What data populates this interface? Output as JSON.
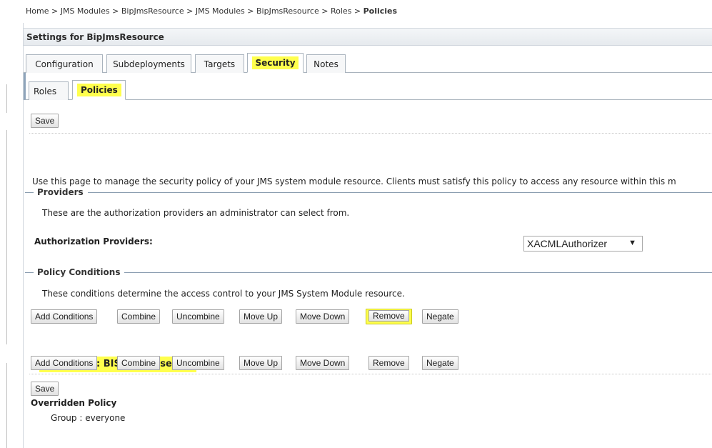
{
  "breadcrumb": {
    "items": [
      "Home",
      "JMS Modules",
      "BipJmsResource",
      "JMS Modules",
      "BipJmsResource",
      "Roles"
    ],
    "current": "Policies",
    "separator": ">"
  },
  "settings": {
    "title": "Settings for BipJmsResource"
  },
  "tabs": {
    "configuration": "Configuration",
    "subdeployments": "Subdeployments",
    "targets": "Targets",
    "security": "Security",
    "notes": "Notes"
  },
  "subtabs": {
    "roles": "Roles",
    "policies": "Policies"
  },
  "buttons": {
    "save": "Save",
    "add_conditions": "Add Conditions",
    "combine": "Combine",
    "uncombine": "Uncombine",
    "move_up": "Move Up",
    "move_down": "Move Down",
    "remove": "Remove",
    "negate": "Negate"
  },
  "description": "Use this page to manage the security policy of your JMS system module resource. Clients must satisfy this policy to access any resource within this m",
  "providers": {
    "title": "Providers",
    "text": "These are the authorization providers an administrator can select from.",
    "label": "Authorization Providers:",
    "selected": "XACMLAuthorizer"
  },
  "policy_conditions": {
    "title": "Policy Conditions",
    "text": "These conditions determine the access control to your JMS System Module resource.",
    "condition": "User : BISystemUser"
  },
  "overridden": {
    "title": "Overridden Policy",
    "value": "Group : everyone"
  },
  "colors": {
    "highlight": "#ffff4d",
    "section_line": "#8a9db0"
  }
}
